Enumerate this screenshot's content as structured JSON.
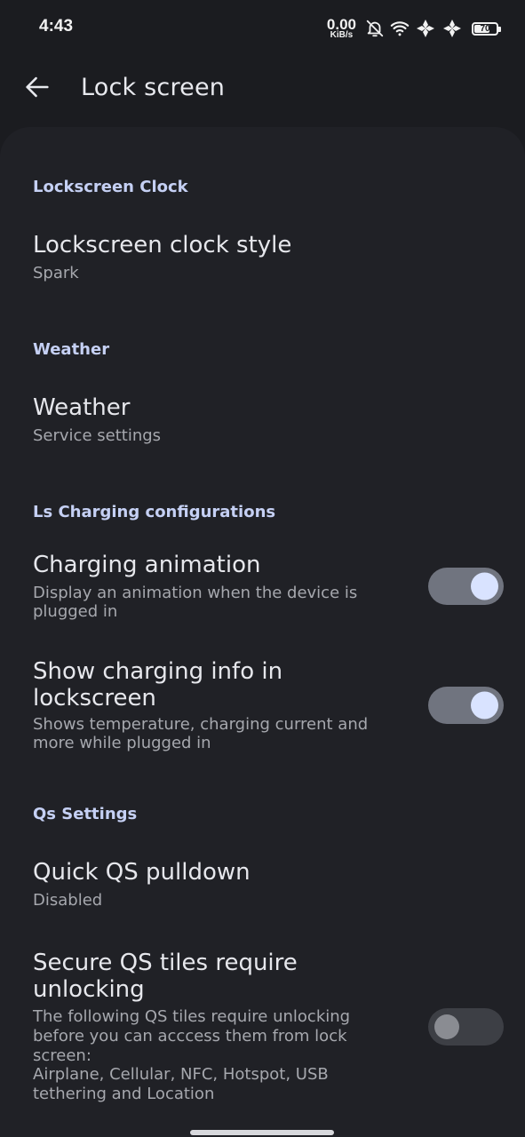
{
  "status_bar": {
    "time": "4:43",
    "net_speed_value": "0.00",
    "net_speed_unit": "KiB/s",
    "battery_level": "70",
    "icons": [
      "bell-off-icon",
      "wifi-icon",
      "signal-icon",
      "signal-icon",
      "battery-icon"
    ]
  },
  "app_bar": {
    "back_icon": "arrow-left-icon",
    "title": "Lock screen"
  },
  "sections": {
    "clock": {
      "header": "Lockscreen Clock",
      "style_title": "Lockscreen clock style",
      "style_summary": "Spark"
    },
    "weather": {
      "header": "Weather",
      "title": "Weather",
      "summary": "Service settings"
    },
    "charging": {
      "header": "Ls Charging configurations",
      "animation_title": "Charging animation",
      "animation_summary_1": "Display an animation when the device is",
      "animation_summary_2": "plugged in",
      "animation_enabled": true,
      "info_title_1": "Show charging info in",
      "info_title_2": "lockscreen",
      "info_summary_1": "Shows temperature, charging current and",
      "info_summary_2": "more while plugged in",
      "info_enabled": true
    },
    "qs": {
      "header": "Qs Settings",
      "pulldown_title": "Quick QS pulldown",
      "pulldown_summary": "Disabled",
      "secure_title_1": "Secure QS tiles require",
      "secure_title_2": "unlocking",
      "secure_summary_1": "The following QS tiles require unlocking",
      "secure_summary_2": "before you can acccess them from lock",
      "secure_summary_3": "screen:",
      "secure_summary_4": "Airplane, Cellular, NFC, Hotspot, USB",
      "secure_summary_5": "tethering and Location",
      "secure_enabled": false
    }
  },
  "colors": {
    "background": "#1b1c20",
    "card": "#202126",
    "section_header": "#c5d0f4",
    "toggle_on_track": "#70747f",
    "toggle_on_knob": "#d9e3ff"
  }
}
